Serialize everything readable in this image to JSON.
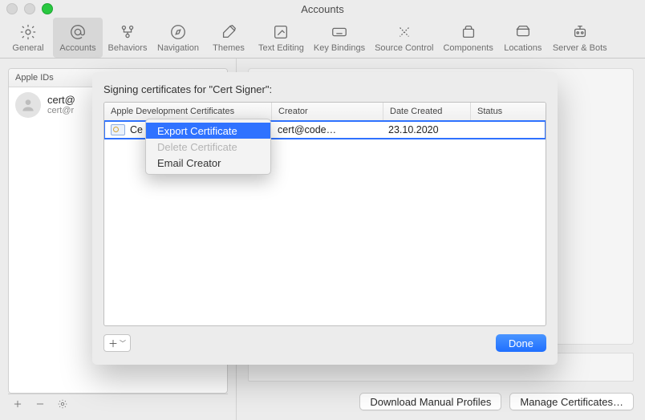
{
  "window": {
    "title": "Accounts"
  },
  "toolbar": {
    "items": [
      {
        "label": "General"
      },
      {
        "label": "Accounts"
      },
      {
        "label": "Behaviors"
      },
      {
        "label": "Navigation"
      },
      {
        "label": "Themes"
      },
      {
        "label": "Text Editing"
      },
      {
        "label": "Key Bindings"
      },
      {
        "label": "Source Control"
      },
      {
        "label": "Components"
      },
      {
        "label": "Locations"
      },
      {
        "label": "Server & Bots"
      }
    ]
  },
  "left_panel": {
    "header": "Apple IDs",
    "account_primary": "cert@",
    "account_secondary": "cert@r"
  },
  "right_panel": {
    "download_btn": "Download Manual Profiles",
    "manage_btn": "Manage Certificates…"
  },
  "sheet": {
    "title": "Signing certificates for \"Cert Signer\":",
    "columns": {
      "c1": "Apple Development Certificates",
      "c2": "Creator",
      "c3": "Date Created",
      "c4": "Status"
    },
    "rows": [
      {
        "name": "Ce",
        "creator": "cert@code…",
        "date": "23.10.2020",
        "status": ""
      }
    ],
    "done": "Done"
  },
  "context_menu": {
    "items": [
      {
        "label": "Export Certificate",
        "state": "hl"
      },
      {
        "label": "Delete Certificate",
        "state": "disabled"
      },
      {
        "label": "Email Creator",
        "state": "normal"
      }
    ]
  }
}
